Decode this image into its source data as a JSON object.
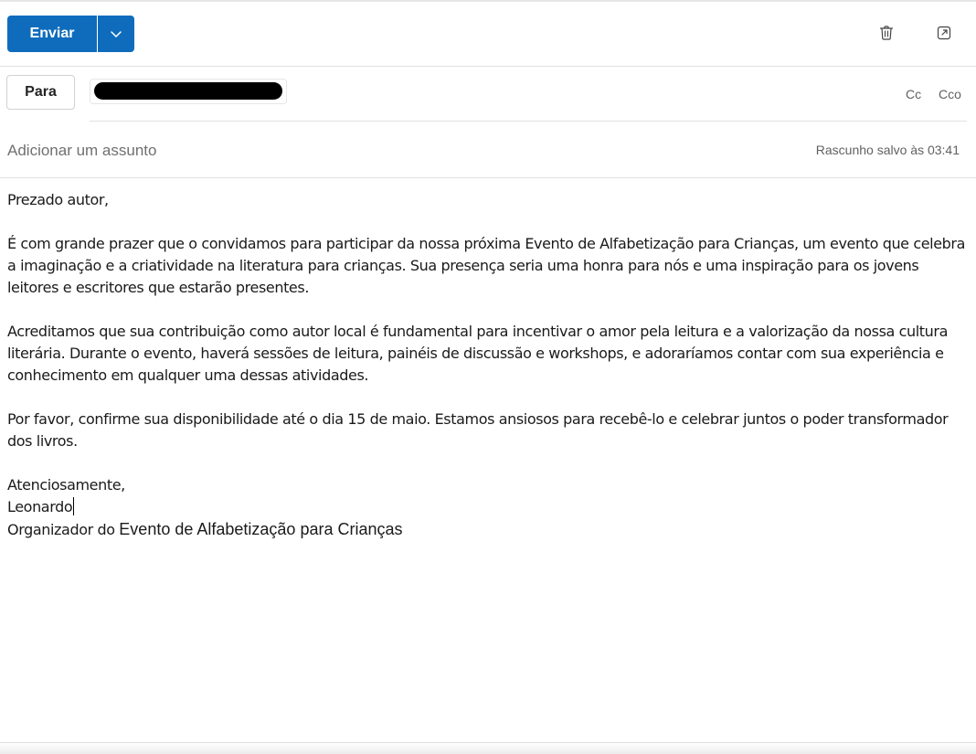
{
  "toolbar": {
    "send_label": "Enviar",
    "icons": [
      "chevron-down-icon",
      "trash-icon",
      "popout-icon"
    ]
  },
  "recipients": {
    "to_label": "Para",
    "recipient_redacted": true,
    "cc_label": "Cc",
    "bcc_label": "Cco"
  },
  "subject": {
    "value": "",
    "placeholder": "Adicionar um assunto",
    "draft_status": "Rascunho salvo às 03:41"
  },
  "body": {
    "greeting": "Prezado autor,",
    "paragraphs": [
      "É com grande prazer que o convidamos para participar da nossa próxima Evento de Alfabetização para Crianças, um evento que celebra a imaginação e a criatividade na literatura para crianças. Sua presença seria uma honra para nós e uma inspiração para os jovens leitores e escritores que estarão presentes.",
      "Acreditamos que sua contribuição como autor local é fundamental para incentivar o amor pela leitura e a valorização da nossa cultura literária. Durante o evento, haverá sessões de leitura, painéis de discussão e workshops, e adoraríamos contar com sua experiência e conhecimento em qualquer uma dessas atividades.",
      "Por favor, confirme sua disponibilidade até o dia 15 de maio. Estamos ansiosos para recebê-lo e celebrar juntos o poder transformador dos livros."
    ],
    "closing": "Atenciosamente,",
    "signature_name": "Leonardo",
    "signature_role_prefix": "Organizador do ",
    "signature_role_event": "Evento de Alfabetização para Crianças"
  },
  "colors": {
    "accent": "#0f6cbd",
    "border": "#e1e1e1",
    "muted_text": "#616161"
  }
}
